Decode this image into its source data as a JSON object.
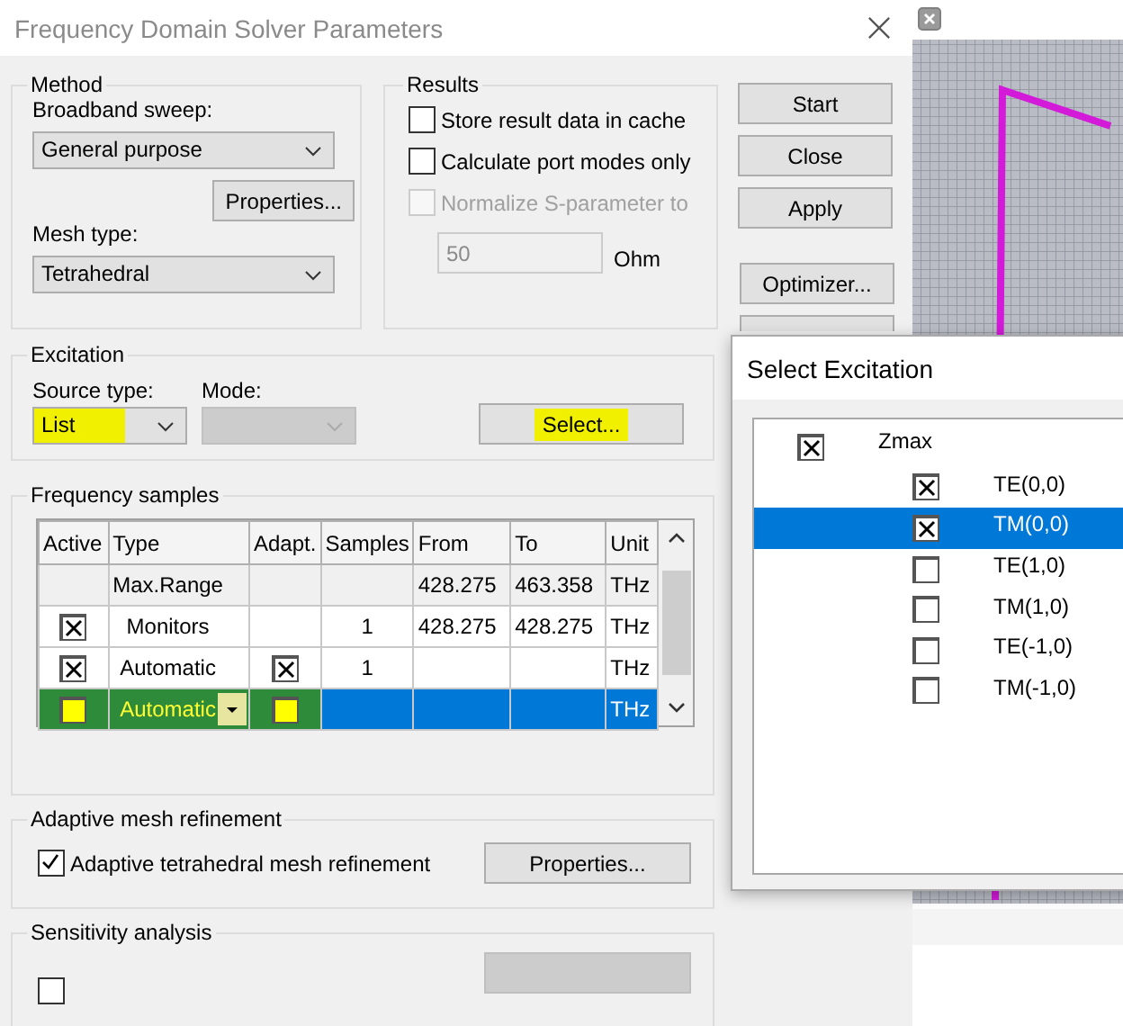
{
  "dialog": {
    "title": "Frequency Domain Solver Parameters"
  },
  "method": {
    "legend": "Method",
    "sweep_label": "Broadband sweep:",
    "sweep_value": "General purpose",
    "properties": "Properties...",
    "mesh_label": "Mesh type:",
    "mesh_value": "Tetrahedral"
  },
  "results": {
    "legend": "Results",
    "options": [
      {
        "label": "Store result data in cache",
        "checked": false,
        "disabled": false
      },
      {
        "label": "Calculate port modes only",
        "checked": false,
        "disabled": false
      },
      {
        "label": "Normalize S-parameter to",
        "checked": false,
        "disabled": true
      }
    ],
    "impedance": {
      "value": "50",
      "unit": "Ohm",
      "disabled": true
    }
  },
  "buttons": [
    {
      "label": "Start"
    },
    {
      "label": "Close"
    },
    {
      "label": "Apply"
    },
    {
      "label": "Optimizer..."
    }
  ],
  "excitation": {
    "legend": "Excitation",
    "source_label": "Source type:",
    "source_value": "List",
    "source_highlighted": true,
    "mode_label": "Mode:",
    "mode_disabled": true,
    "select": {
      "label": "Select...",
      "highlighted": true
    }
  },
  "frequency_samples": {
    "legend": "Frequency samples",
    "columns": [
      "Active",
      "Type",
      "Adapt.",
      "Samples",
      "From",
      "To",
      "Unit"
    ],
    "rows": [
      {
        "kind": "fixed",
        "selected": false,
        "highlighted": false,
        "type": "Max.Range",
        "from": "428.275",
        "to": "463.358",
        "unit": "THz"
      },
      {
        "kind": "normal",
        "selected": false,
        "highlighted": false,
        "active": true,
        "type": "Monitors",
        "samples": "1",
        "from": "428.275",
        "to": "428.275",
        "unit": "THz"
      },
      {
        "kind": "normal",
        "selected": false,
        "highlighted": false,
        "active": true,
        "adapt": true,
        "type": "Automatic",
        "samples": "1",
        "unit": "THz"
      },
      {
        "kind": "editing",
        "selected": true,
        "highlighted": true,
        "active": false,
        "adapt": false,
        "type": "Automatic",
        "unit": "THz"
      }
    ]
  },
  "adaptive": {
    "legend": "Adaptive mesh refinement",
    "option": {
      "label": "Adaptive tetrahedral mesh refinement",
      "checked": true
    },
    "properties": "Properties..."
  },
  "sensitivity": {
    "legend": "Sensitivity analysis",
    "checked": false,
    "properties_disabled": true
  },
  "select_excitation": {
    "title": "Select Excitation",
    "ports": [
      {
        "label": "Zmax",
        "checked": true,
        "selected": false,
        "children": [
          {
            "label": "TE(0,0)",
            "checked": true,
            "selected": false
          },
          {
            "label": "TM(0,0)",
            "checked": true,
            "selected": true
          },
          {
            "label": "TE(1,0)",
            "checked": false,
            "selected": false
          },
          {
            "label": "TM(1,0)",
            "checked": false,
            "selected": false
          },
          {
            "label": "TE(-1,0)",
            "checked": false,
            "selected": false
          },
          {
            "label": "TM(-1,0)",
            "checked": false,
            "selected": false
          }
        ]
      }
    ]
  }
}
